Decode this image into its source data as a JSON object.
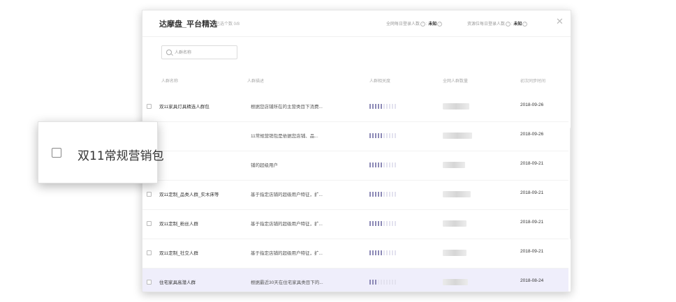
{
  "header": {
    "title": "达摩盘_平台精选",
    "selected_count": "已选个数 0/8",
    "stat1_label": "全网每日登录人数",
    "stat1_value": "未知",
    "stat2_label": "资源位每日登录人数",
    "stat2_value": "未知",
    "close": "✕"
  },
  "search": {
    "placeholder": "人群名称",
    "value": ""
  },
  "columns": [
    "人群名称",
    "人群描述",
    "人群相关度",
    "全网人群数量",
    "初次同步时间"
  ],
  "rows": [
    {
      "name": "双11家具灯具精选人群包",
      "desc": "根据您店铺所在的主营类目下消费...",
      "relevance": 5,
      "date": "2018-09-26"
    },
    {
      "name": "",
      "desc": "11常规营销包是依据您店铺、品...",
      "relevance": 5,
      "date": "2018-09-26"
    },
    {
      "name": "",
      "desc": "铺的超级用户",
      "relevance": 5,
      "date": "2018-09-21"
    },
    {
      "name": "双11定制_品类人群_实木床等",
      "desc": "基于指定店铺的超级用户特征，扩...",
      "relevance": 5,
      "date": "2018-09-21"
    },
    {
      "name": "双11定制_粉丝人群",
      "desc": "基于指定店铺的超级用户特征，扩...",
      "relevance": 5,
      "date": "2018-09-21"
    },
    {
      "name": "双11定制_社交人群",
      "desc": "基于指定店铺的超级用户特征，扩...",
      "relevance": 5,
      "date": "2018-09-21"
    },
    {
      "name": "住宅家具高潜人群",
      "desc": "根据最近30天在住宅家具类目下的...",
      "relevance": 3,
      "date": "2018-08-24"
    }
  ],
  "popup": {
    "label": "双11常规营销包"
  },
  "colors": {
    "accent": "#8c89b6",
    "row_highlight": "#efeefb"
  }
}
